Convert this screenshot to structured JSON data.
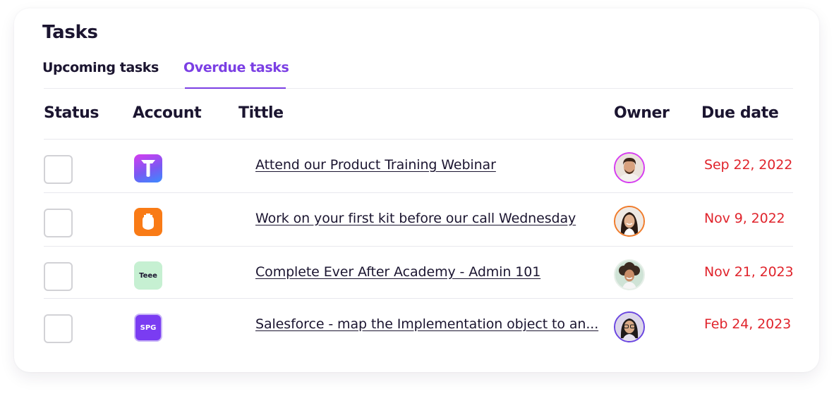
{
  "header": {
    "title": "Tasks"
  },
  "tabs": [
    {
      "label": "Upcoming tasks",
      "active": false
    },
    {
      "label": "Overdue tasks",
      "active": true
    }
  ],
  "columns": {
    "status": "Status",
    "account": "Account",
    "title": "Tittle",
    "owner": "Owner",
    "due": "Due date"
  },
  "colors": {
    "accent": "#7b3fe4",
    "overdue": "#e0242c"
  },
  "rows": [
    {
      "checked": false,
      "account_logo": "gradient-brand-logo",
      "account_text": "",
      "title": "Attend our Product Training Webinar",
      "owner_avatar": "man-avatar",
      "due": "Sep 22, 2022"
    },
    {
      "checked": false,
      "account_logo": "orange-shield-logo",
      "account_text": "",
      "title": "Work on your first kit before our call Wednesday",
      "owner_avatar": "woman-avatar",
      "due": "Nov 9, 2022"
    },
    {
      "checked": false,
      "account_logo": "teee-logo",
      "account_text": "Teee",
      "title": "Complete Ever After Academy - Admin 101",
      "owner_avatar": "woman-curly-avatar",
      "due": "Nov 21, 2023"
    },
    {
      "checked": false,
      "account_logo": "spg-logo",
      "account_text": "SPG",
      "title": "Salesforce - map the Implementation object to an...",
      "owner_avatar": "woman-glasses-avatar",
      "due": "Feb 24, 2023"
    }
  ]
}
